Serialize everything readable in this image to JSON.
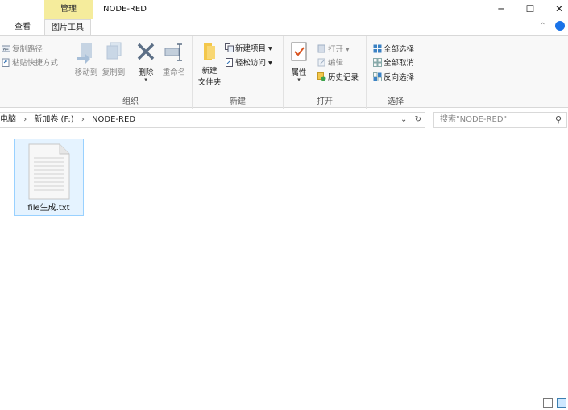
{
  "window": {
    "title": "NODE-RED",
    "contextual_tab_group": "管理",
    "controls": {
      "minimize": "─",
      "maximize": "☐",
      "close": "✕"
    }
  },
  "tabs": [
    {
      "label": "查看",
      "active": false
    },
    {
      "label": "图片工具",
      "active": true
    }
  ],
  "ribbon": {
    "clipboard_partial": {
      "copy_path": "复制路径",
      "paste_shortcut": "粘贴快捷方式"
    },
    "organize": {
      "label": "组织",
      "move_to": "移动到",
      "copy_to": "复制到",
      "delete": "删除",
      "rename": "重命名"
    },
    "new": {
      "label": "新建",
      "new_folder_line1": "新建",
      "new_folder_line2": "文件夹",
      "new_item": "新建项目 ▾",
      "easy_access": "轻松访问 ▾"
    },
    "open": {
      "label": "打开",
      "properties": "属性",
      "open": "打开 ▾",
      "edit": "编辑",
      "history": "历史记录"
    },
    "select": {
      "label": "选择",
      "select_all": "全部选择",
      "select_none": "全部取消",
      "invert": "反向选择"
    }
  },
  "address": {
    "crumbs": [
      "此电脑",
      "新加卷 (F:)",
      "NODE-RED"
    ],
    "search_placeholder": "搜索\"NODE-RED\""
  },
  "files": [
    {
      "name": "file生成.txt"
    }
  ],
  "colors": {
    "accent": "#1a73e8",
    "context_tab": "#f5ec9c",
    "selection_bg": "#e5f3ff",
    "selection_border": "#99d1ff"
  }
}
